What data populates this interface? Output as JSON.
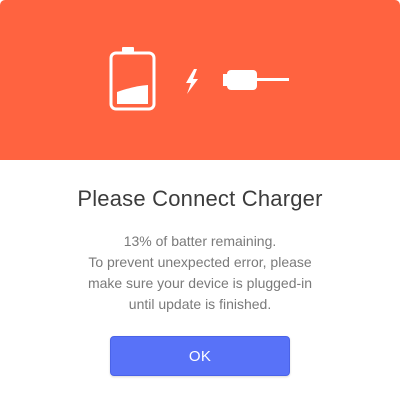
{
  "dialog": {
    "title": "Please Connect Charger",
    "message_lines": [
      "13% of batter remaining.",
      "To prevent unexpected error, please",
      "make sure your device is plugged-in",
      "until update is finished."
    ],
    "ok_label": "OK"
  },
  "battery": {
    "level_percent": 13
  },
  "icons": [
    "battery-low-icon",
    "lightning-bolt-icon",
    "charger-plug-icon"
  ],
  "colors": {
    "banner": "#ff6340",
    "button": "#5872f8",
    "title_text": "#3c3c3c",
    "body_text": "#7a7a7a",
    "icon": "#ffffff"
  }
}
